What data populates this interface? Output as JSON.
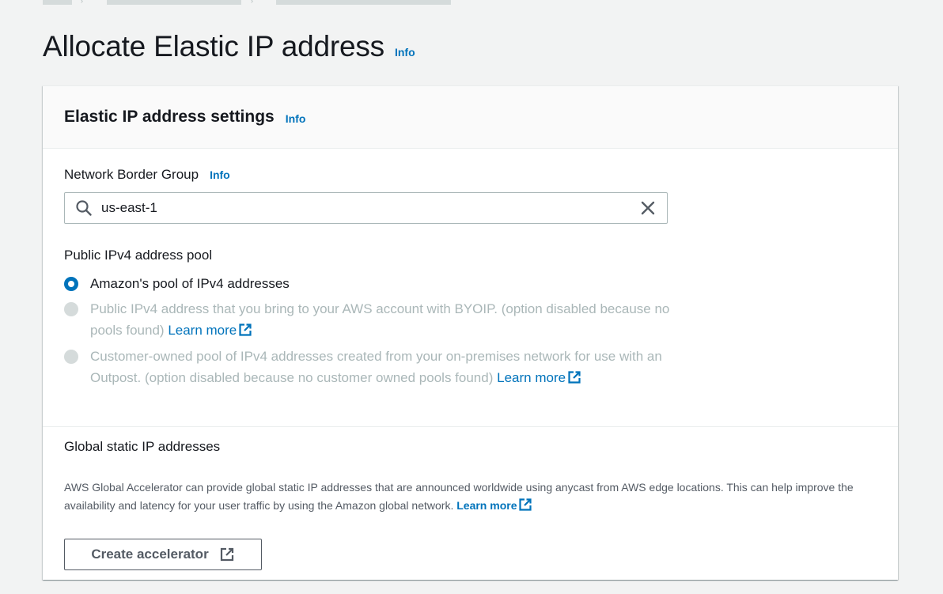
{
  "page": {
    "title": "Allocate Elastic IP address",
    "info_label": "Info"
  },
  "panel": {
    "title": "Elastic IP address settings",
    "info_label": "Info",
    "network_border_group": {
      "label": "Network Border Group",
      "info_label": "Info",
      "value": "us-east-1"
    },
    "ipv4_pool": {
      "label": "Public IPv4 address pool",
      "options": [
        {
          "text": "Amazon's pool of IPv4 addresses",
          "selected": true,
          "disabled": false
        },
        {
          "text": "Public IPv4 address that you bring to your AWS account with BYOIP. (option disabled because no pools found)",
          "link": "Learn more",
          "selected": false,
          "disabled": true
        },
        {
          "text": "Customer-owned pool of IPv4 addresses created from your on-premises network for use with an Outpost. (option disabled because no customer owned pools found)",
          "link": "Learn more",
          "selected": false,
          "disabled": true
        }
      ]
    },
    "global_static": {
      "label": "Global static IP addresses",
      "description": "AWS Global Accelerator can provide global static IP addresses that are announced worldwide using anycast from AWS edge locations. This can help improve the availability and latency for your user traffic by using the Amazon global network.",
      "link": "Learn more",
      "button_label": "Create accelerator"
    }
  },
  "colors": {
    "accent": "#0073bb",
    "disabled": "#aab7b8",
    "text": "#16191f",
    "background": "#f2f3f3"
  },
  "icons": {
    "search": "search-icon",
    "clear": "close-icon",
    "external": "external-link-icon"
  }
}
